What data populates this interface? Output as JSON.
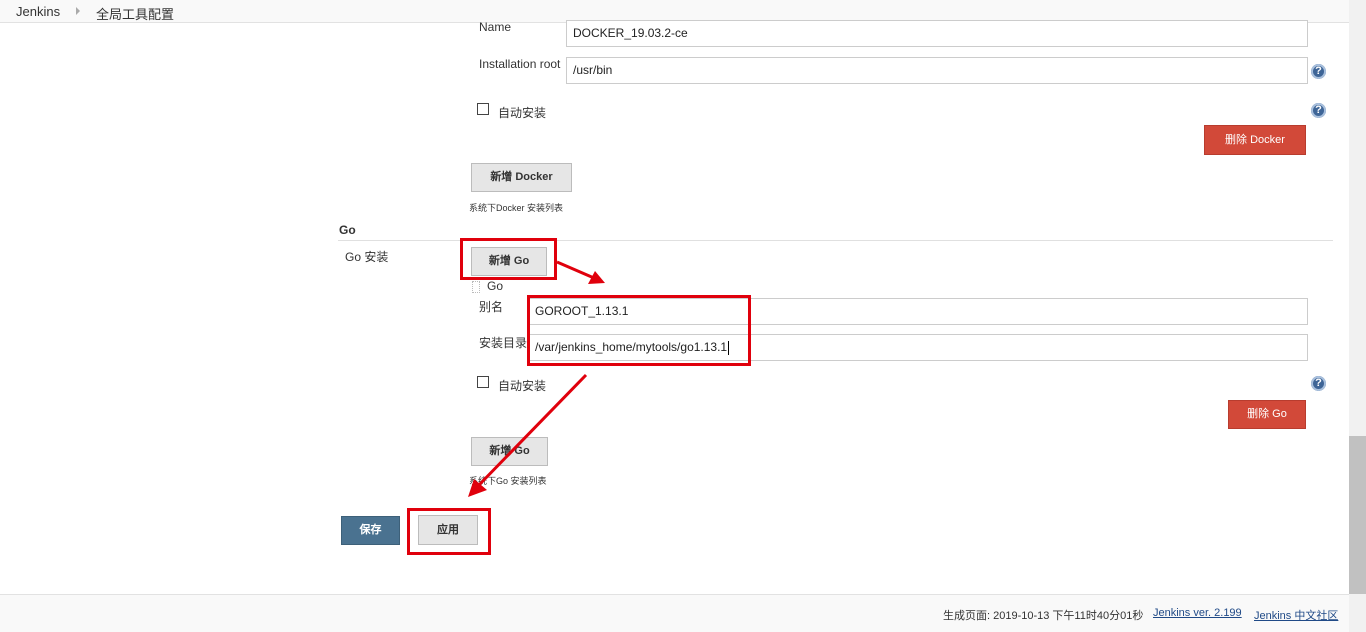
{
  "breadcrumb": {
    "home": "Jenkins",
    "current": "全局工具配置"
  },
  "docker": {
    "name_label": "Name",
    "name_value": "DOCKER_19.03.2-ce",
    "root_label": "Installation root",
    "root_value": "/usr/bin",
    "auto_install_label": "自动安装",
    "delete_button": "删除 Docker",
    "add_button": "新增 Docker",
    "hint": "系统下Docker 安装列表"
  },
  "go": {
    "section_title": "Go",
    "install_label": "Go 安装",
    "add_button_top": "新增 Go",
    "item_header": "Go",
    "alias_label": "别名",
    "alias_value": "GOROOT_1.13.1",
    "dir_label": "安装目录",
    "dir_value": "/var/jenkins_home/mytools/go1.13.1",
    "auto_install_label": "自动安装",
    "delete_button": "删除 Go",
    "add_button_bottom": "新增 Go",
    "hint": "系统下Go 安装列表"
  },
  "actions": {
    "save": "保存",
    "apply": "应用"
  },
  "help_icon_glyph": "?",
  "footer": {
    "generated": "生成页面: 2019-10-13 下午11时40分01秒",
    "version_link": "Jenkins ver. 2.199",
    "community_link": "Jenkins 中文社区"
  },
  "colors": {
    "annotation": "#e0000c",
    "delete_button": "#d24939",
    "save_button": "#4a7290"
  }
}
